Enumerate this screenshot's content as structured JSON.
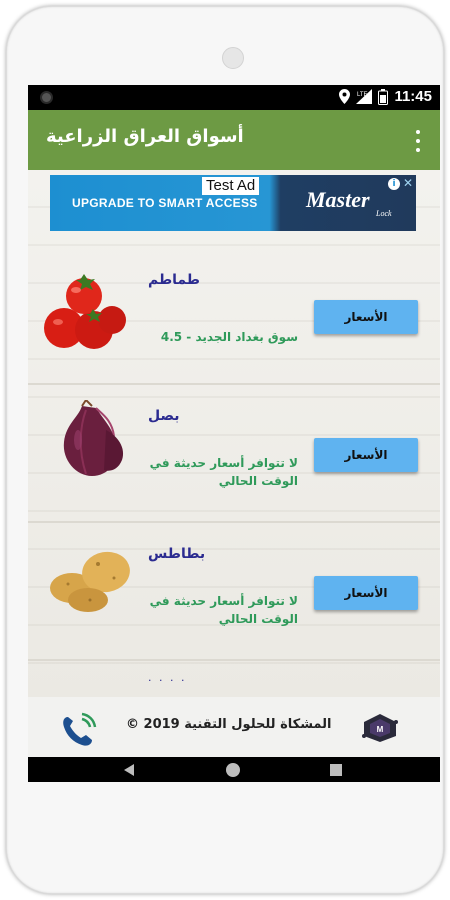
{
  "status_bar": {
    "time": "11:45",
    "icons": [
      "location-icon",
      "signal-icon",
      "battery-icon"
    ]
  },
  "app_bar": {
    "title": "أسواق العراق الزراعية",
    "menu_icon": "overflow-menu-icon"
  },
  "ad": {
    "badge": "Test Ad",
    "cta": "UPGRADE TO SMART ACCESS",
    "brand": "Master",
    "brand_sub": "Lock",
    "colors": {
      "left": "#1d8fd1",
      "right": "#203a5c"
    }
  },
  "items": [
    {
      "name": "طماطم",
      "status": "سوق بغداد الجديد - 4.5",
      "button": "الأسعار",
      "image": "tomato-image"
    },
    {
      "name": "بصل",
      "status": "لا تتوافر أسعار حديثة في الوقت الحالي",
      "button": "الأسعار",
      "image": "onion-image"
    },
    {
      "name": "بطاطس",
      "status": "لا تتوافر أسعار حديثة في الوقت الحالي",
      "button": "الأسعار",
      "image": "potato-image"
    }
  ],
  "footer": {
    "text": "المشكاة للحلول التقنية 2019 ©",
    "logo": "mishkat-logo-icon",
    "call_icon": "phone-call-icon"
  },
  "colors": {
    "app_bar": "#6d9a44",
    "button": "#5fb3f0",
    "item_name": "#2b2b90",
    "item_status": "#2f9a5a"
  }
}
